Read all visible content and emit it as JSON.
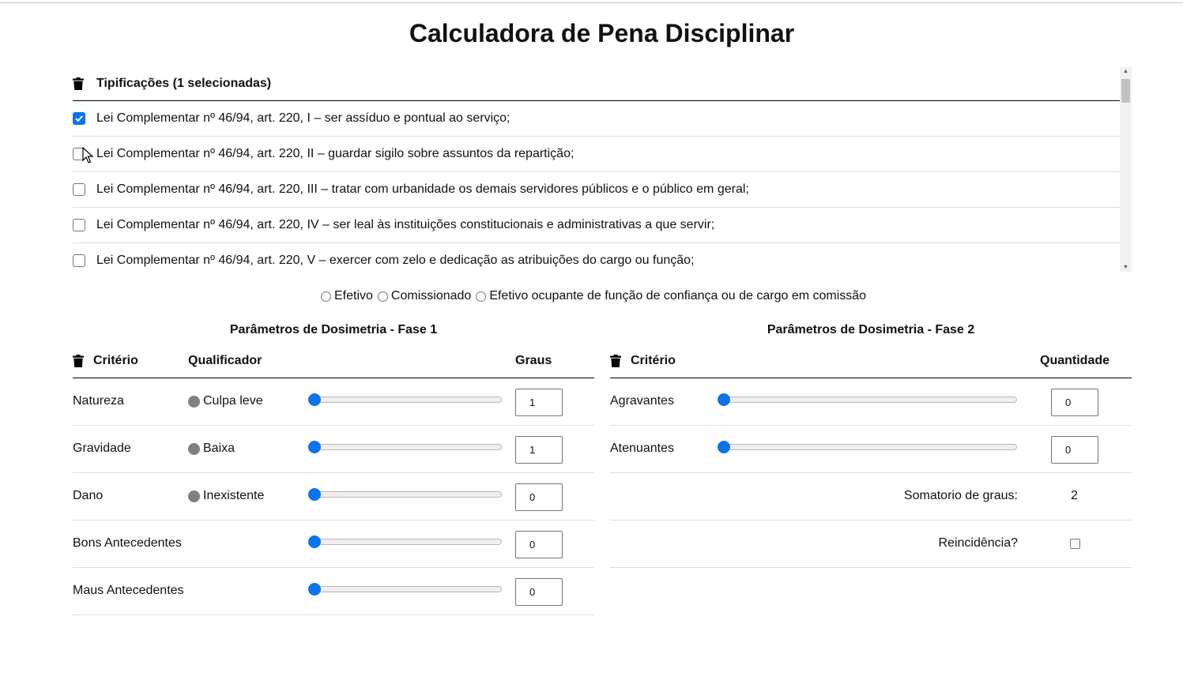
{
  "page": {
    "title": "Calculadora de Pena Disciplinar"
  },
  "tipificacoes": {
    "header": "Tipificações (1 selecionadas)",
    "items": [
      {
        "label": "Lei Complementar nº 46/94, art. 220, I – ser assíduo e pontual ao serviço;",
        "checked": true
      },
      {
        "label": "Lei Complementar nº 46/94, art. 220, II – guardar sigilo sobre assuntos da repartição;",
        "checked": false
      },
      {
        "label": "Lei Complementar nº 46/94, art. 220, III – tratar com urbanidade os demais servidores públicos e o público em geral;",
        "checked": false
      },
      {
        "label": "Lei Complementar nº 46/94, art. 220, IV – ser leal às instituições constitucionais e administrativas a que servir;",
        "checked": false
      },
      {
        "label": "Lei Complementar nº 46/94, art. 220, V – exercer com zelo e dedicação as atribuições do cargo ou função;",
        "checked": false
      }
    ]
  },
  "vinculo": {
    "options": [
      {
        "label": "Efetivo",
        "selected": false
      },
      {
        "label": "Comissionado",
        "selected": false
      },
      {
        "label": "Efetivo ocupante de função de confiança ou de cargo em comissão",
        "selected": false
      }
    ]
  },
  "fase1": {
    "title": "Parâmetros de Dosimetria - Fase 1",
    "headers": {
      "criterio": "Critério",
      "qualificador": "Qualificador",
      "graus": "Graus"
    },
    "rows": [
      {
        "criterio": "Natureza",
        "qualificador": "Culpa leve",
        "graus": "1",
        "slider_fraction": 0
      },
      {
        "criterio": "Gravidade",
        "qualificador": "Baixa",
        "graus": "1",
        "slider_fraction": 0
      },
      {
        "criterio": "Dano",
        "qualificador": "Inexistente",
        "graus": "0",
        "slider_fraction": 0
      },
      {
        "criterio": "Bons Antecedentes",
        "qualificador": "",
        "graus": "0",
        "slider_fraction": 0
      },
      {
        "criterio": "Maus Antecedentes",
        "qualificador": "",
        "graus": "0",
        "slider_fraction": 0
      }
    ]
  },
  "fase2": {
    "title": "Parâmetros de Dosimetria - Fase 2",
    "headers": {
      "criterio": "Critério",
      "quantidade": "Quantidade"
    },
    "rows": [
      {
        "criterio": "Agravantes",
        "quantidade": "0",
        "slider_fraction": 0
      },
      {
        "criterio": "Atenuantes",
        "quantidade": "0",
        "slider_fraction": 0
      }
    ],
    "somatorio_label": "Somatorio de graus:",
    "somatorio_value": "2",
    "reincidencia_label": "Reincidência?",
    "reincidencia_checked": false
  },
  "colors": {
    "accent": "#0b74ec",
    "qualifier_dot": "#808080"
  },
  "icons": {
    "trash": "trash-icon",
    "cursor": "mouse-pointer-icon"
  }
}
